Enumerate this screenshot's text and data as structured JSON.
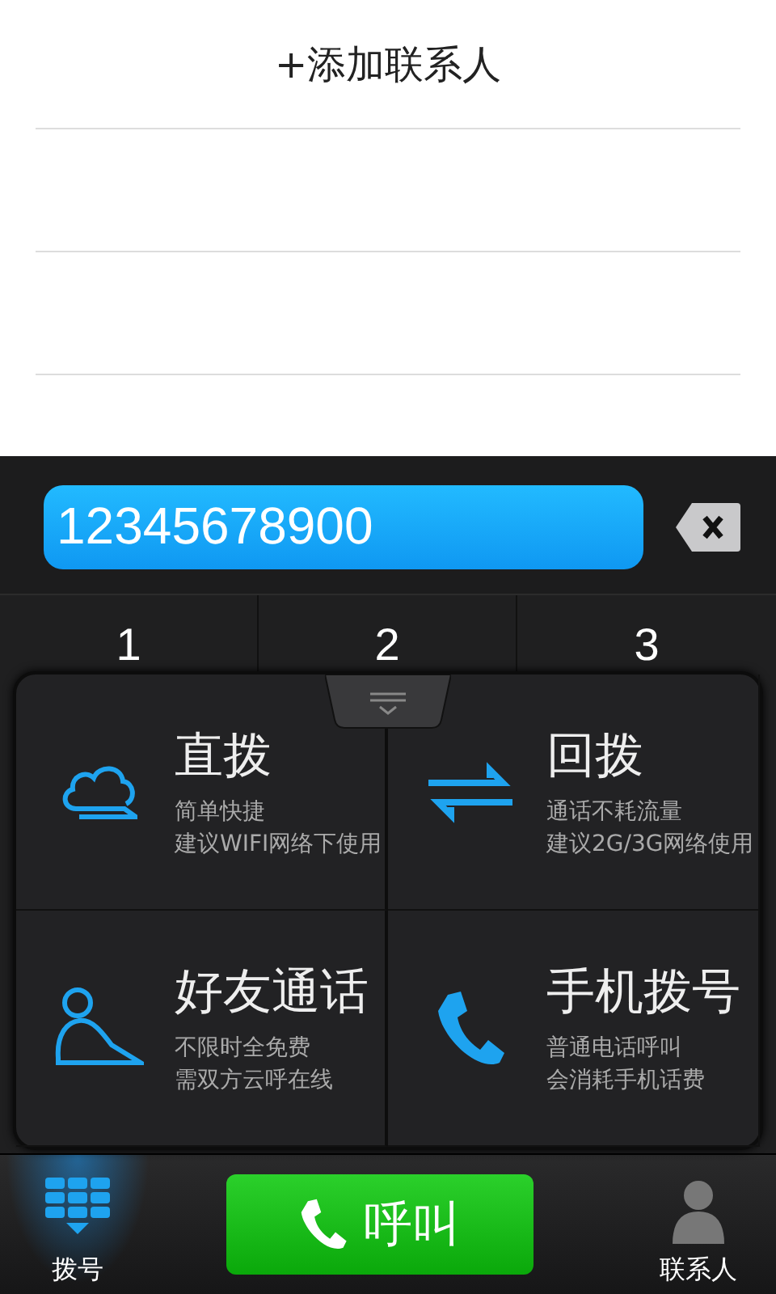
{
  "header": {
    "add_contact": "+添加联系人"
  },
  "dial_input": {
    "value": "12345678900"
  },
  "keypad": [
    {
      "digit": "1"
    },
    {
      "digit": "2"
    },
    {
      "digit": "3"
    }
  ],
  "call_modes": [
    {
      "kind": "cloud",
      "title": "直拨",
      "lines": [
        "简单快捷",
        "建议WIFI网络下使用"
      ]
    },
    {
      "kind": "callback",
      "title": "回拨",
      "lines": [
        "通话不耗流量",
        "建议2G/3G网络使用"
      ]
    },
    {
      "kind": "friend",
      "title": "好友通话",
      "lines": [
        "不限时全免费",
        "需双方云呼在线"
      ]
    },
    {
      "kind": "phone",
      "title": "手机拨号",
      "lines": [
        "普通电话呼叫",
        "会消耗手机话费"
      ]
    }
  ],
  "bottom_bar": {
    "tabs": [
      {
        "kind": "dial",
        "label": "拨号",
        "selected": true
      },
      {
        "kind": "contacts",
        "label": "联系人",
        "selected": false
      }
    ],
    "call_button": "呼叫"
  }
}
